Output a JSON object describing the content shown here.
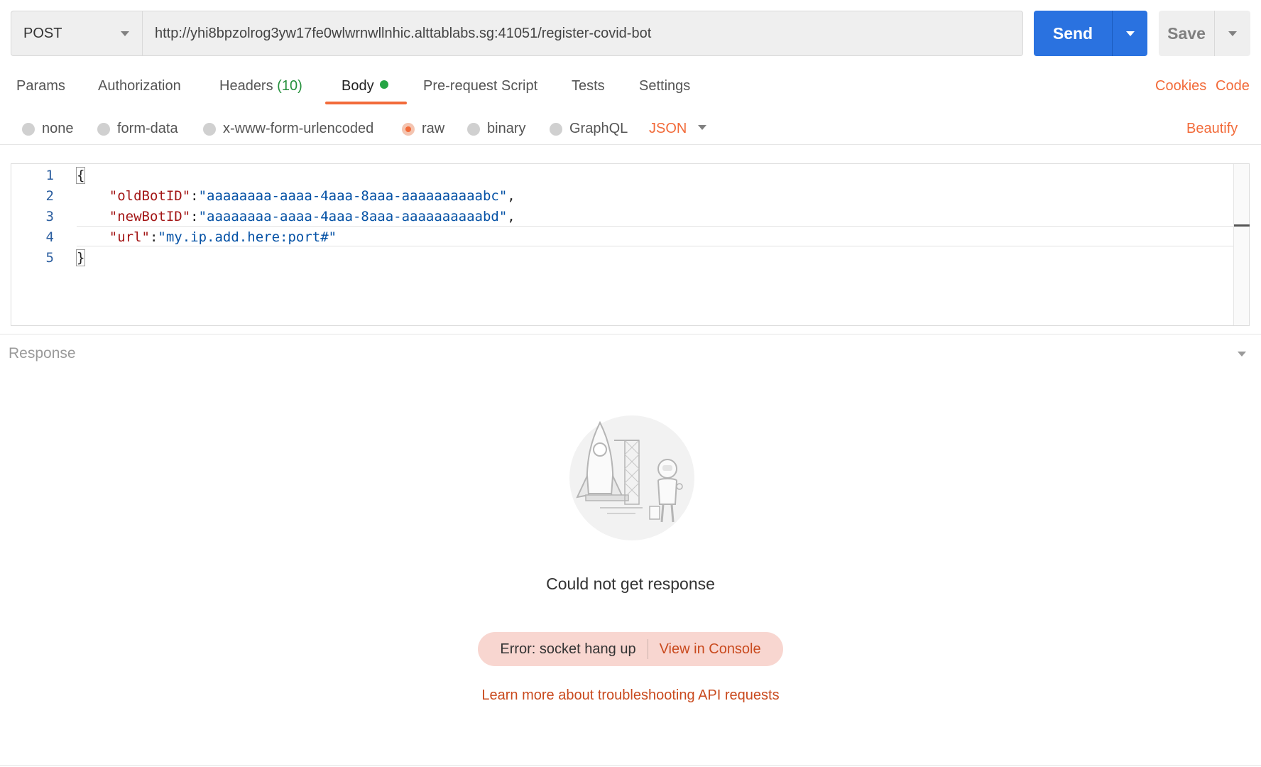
{
  "request": {
    "method": "POST",
    "url": "http://yhi8bpzolrog3yw17fe0wlwrnwllnhic.alttablabs.sg:41051/register-covid-bot",
    "send_label": "Send",
    "save_label": "Save"
  },
  "tabs": {
    "params": "Params",
    "authorization": "Authorization",
    "headers": "Headers",
    "headers_count": "(10)",
    "body": "Body",
    "prerequest": "Pre-request Script",
    "tests": "Tests",
    "settings": "Settings",
    "active": "Body"
  },
  "links": {
    "cookies": "Cookies",
    "code": "Code",
    "beautify": "Beautify"
  },
  "body_types": {
    "none": "none",
    "form_data": "form-data",
    "urlencoded": "x-www-form-urlencoded",
    "raw": "raw",
    "binary": "binary",
    "graphql": "GraphQL",
    "selected": "raw",
    "format": "JSON"
  },
  "editor": {
    "line_numbers": [
      "1",
      "2",
      "3",
      "4",
      "5"
    ],
    "open_brace": "{",
    "close_brace": "}",
    "lines": [
      {
        "key": "\"oldBotID\"",
        "value": "\"aaaaaaaa-aaaa-4aaa-8aaa-aaaaaaaaaabc\"",
        "trail": ","
      },
      {
        "key": "\"newBotID\"",
        "value": "\"aaaaaaaa-aaaa-4aaa-8aaa-aaaaaaaaaabd\"",
        "trail": ","
      },
      {
        "key": "\"url\"",
        "value": "\"my.ip.add.here:port#\"",
        "trail": ""
      }
    ]
  },
  "response": {
    "label": "Response",
    "message": "Could not get response",
    "error": "Error: socket hang up",
    "console_link": "View in Console",
    "learn_more": "Learn more about troubleshooting API requests"
  },
  "colors": {
    "accent": "#f26b3a",
    "send_blue": "#2a72e0",
    "headers_count_green": "#26913d",
    "error_bg": "#f8d6d0",
    "error_link": "#c94a1e"
  }
}
